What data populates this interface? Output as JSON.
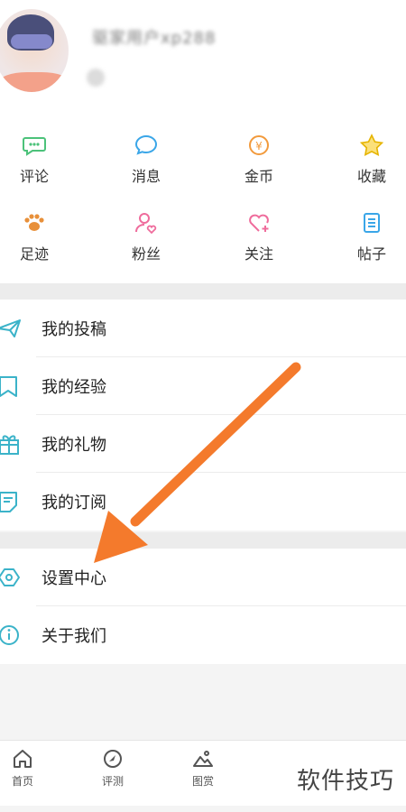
{
  "profile": {
    "username": "驱家用户xp288"
  },
  "grid": [
    {
      "label": "评论",
      "icon": "comment-icon",
      "color": "#4cc27a"
    },
    {
      "label": "消息",
      "icon": "message-icon",
      "color": "#3aa6e8"
    },
    {
      "label": "金币",
      "icon": "coin-icon",
      "color": "#f29a3c"
    },
    {
      "label": "收藏",
      "icon": "star-icon",
      "color": "#e6b400"
    },
    {
      "label": "足迹",
      "icon": "paw-icon",
      "color": "#e8903a"
    },
    {
      "label": "粉丝",
      "icon": "fans-icon",
      "color": "#ef6c9c"
    },
    {
      "label": "关注",
      "icon": "heart-plus-icon",
      "color": "#ef6c9c"
    },
    {
      "label": "帖子",
      "icon": "post-icon",
      "color": "#3aa6e8"
    }
  ],
  "menu_group1": [
    {
      "label": "我的投稿",
      "icon": "paper-plane-icon"
    },
    {
      "label": "我的经验",
      "icon": "bookmark-icon"
    },
    {
      "label": "我的礼物",
      "icon": "gift-icon"
    },
    {
      "label": "我的订阅",
      "icon": "subscribe-icon"
    }
  ],
  "menu_group2": [
    {
      "label": "设置中心",
      "icon": "settings-icon"
    },
    {
      "label": "关于我们",
      "icon": "info-icon"
    }
  ],
  "tabs": [
    {
      "label": "首页",
      "icon": "home-icon"
    },
    {
      "label": "评测",
      "icon": "review-icon"
    },
    {
      "label": "图赏",
      "icon": "gallery-icon"
    }
  ],
  "watermark": "软件技巧",
  "accent": "#3bb3c9",
  "arrow_color": "#f47a2c"
}
